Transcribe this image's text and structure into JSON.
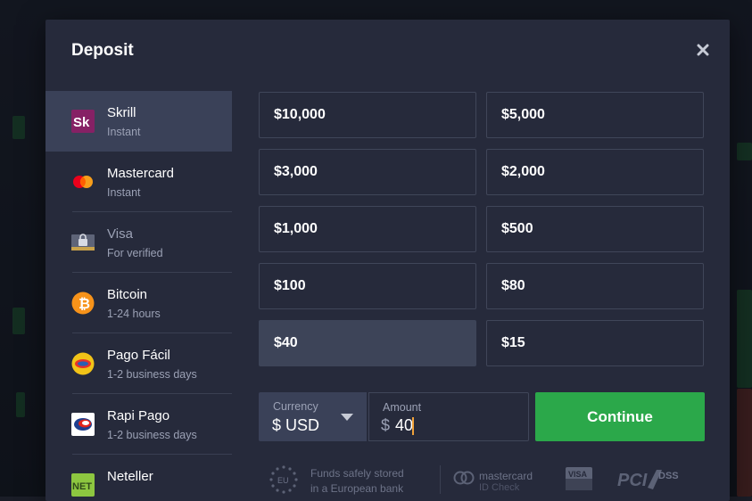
{
  "modal": {
    "title": "Deposit"
  },
  "methods": [
    {
      "name": "Skrill",
      "sub": "Instant",
      "icon": "skrill-logo-icon",
      "active": true
    },
    {
      "name": "Mastercard",
      "sub": "Instant",
      "icon": "mastercard-logo-icon"
    },
    {
      "name": "Visa",
      "sub": "For verified",
      "icon": "visa-locked-icon",
      "dim": true
    },
    {
      "name": "Bitcoin",
      "sub": "1-24 hours",
      "icon": "bitcoin-logo-icon"
    },
    {
      "name": "Pago Fácil",
      "sub": "1-2 business days",
      "icon": "pago-facil-logo-icon"
    },
    {
      "name": "Rapi Pago",
      "sub": "1-2 business days",
      "icon": "rapi-pago-logo-icon"
    },
    {
      "name": "Neteller",
      "sub": "",
      "icon": "neteller-logo-icon"
    }
  ],
  "amounts": [
    "$10,000",
    "$5,000",
    "$3,000",
    "$2,000",
    "$1,000",
    "$500",
    "$100",
    "$80",
    "$40",
    "$15"
  ],
  "selected_amount": "$40",
  "currency": {
    "label": "Currency",
    "value": "$ USD"
  },
  "amount_input": {
    "label": "Amount",
    "prefix": "$",
    "value": "40"
  },
  "continue_label": "Continue",
  "trust": {
    "eu_line1": "Funds safely stored",
    "eu_line2": "in a European bank",
    "eu_badge": "EU",
    "mastercard_line1": "mastercard",
    "mastercard_line2": "ID Check",
    "visa_badge": "VISA",
    "pci_text": "PCI",
    "dss_text": "DSS"
  },
  "colors": {
    "accent_green": "#2ba84a",
    "modal_bg": "#262a3b",
    "active_bg": "#3a4158",
    "cursor": "#f0a23a"
  }
}
